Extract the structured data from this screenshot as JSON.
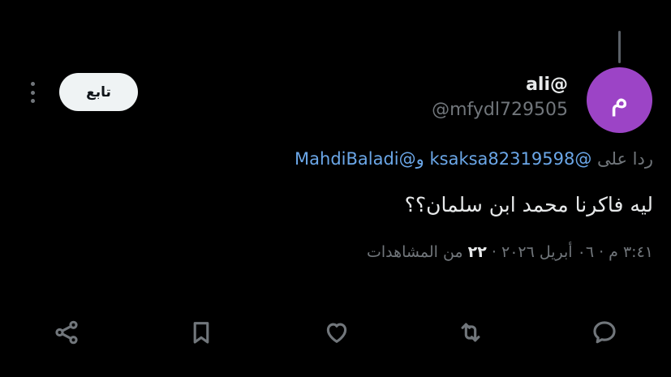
{
  "author": {
    "avatar_letter": "م",
    "avatar_color": "#9c44c6",
    "display_name": "ali@",
    "handle": "@mfydl729505"
  },
  "follow_label": "تابع",
  "reply_to": {
    "prefix": "ردا على",
    "mention_1": "@ksaksa82319598",
    "conjunction": "و",
    "mention_2": "@MahdiBaladi"
  },
  "tweet_text": "ليه فاكرنا محمد ابن سلمان؟؟",
  "meta": {
    "timestamp": "٣:٤١ م · ٠٦ أبريل ٢٠٢٦",
    "separator": " · ",
    "views_count": "٢٢",
    "views_label": "من المشاهدات"
  },
  "actions": {
    "reply_icon": "reply-icon",
    "retweet_icon": "retweet-icon",
    "like_icon": "like-icon",
    "bookmark_icon": "bookmark-icon",
    "share_icon": "share-icon"
  },
  "colors": {
    "background": "#000000",
    "text_primary": "#e7e9ea",
    "text_secondary": "#71767b",
    "mention": "#6ba7e8"
  }
}
